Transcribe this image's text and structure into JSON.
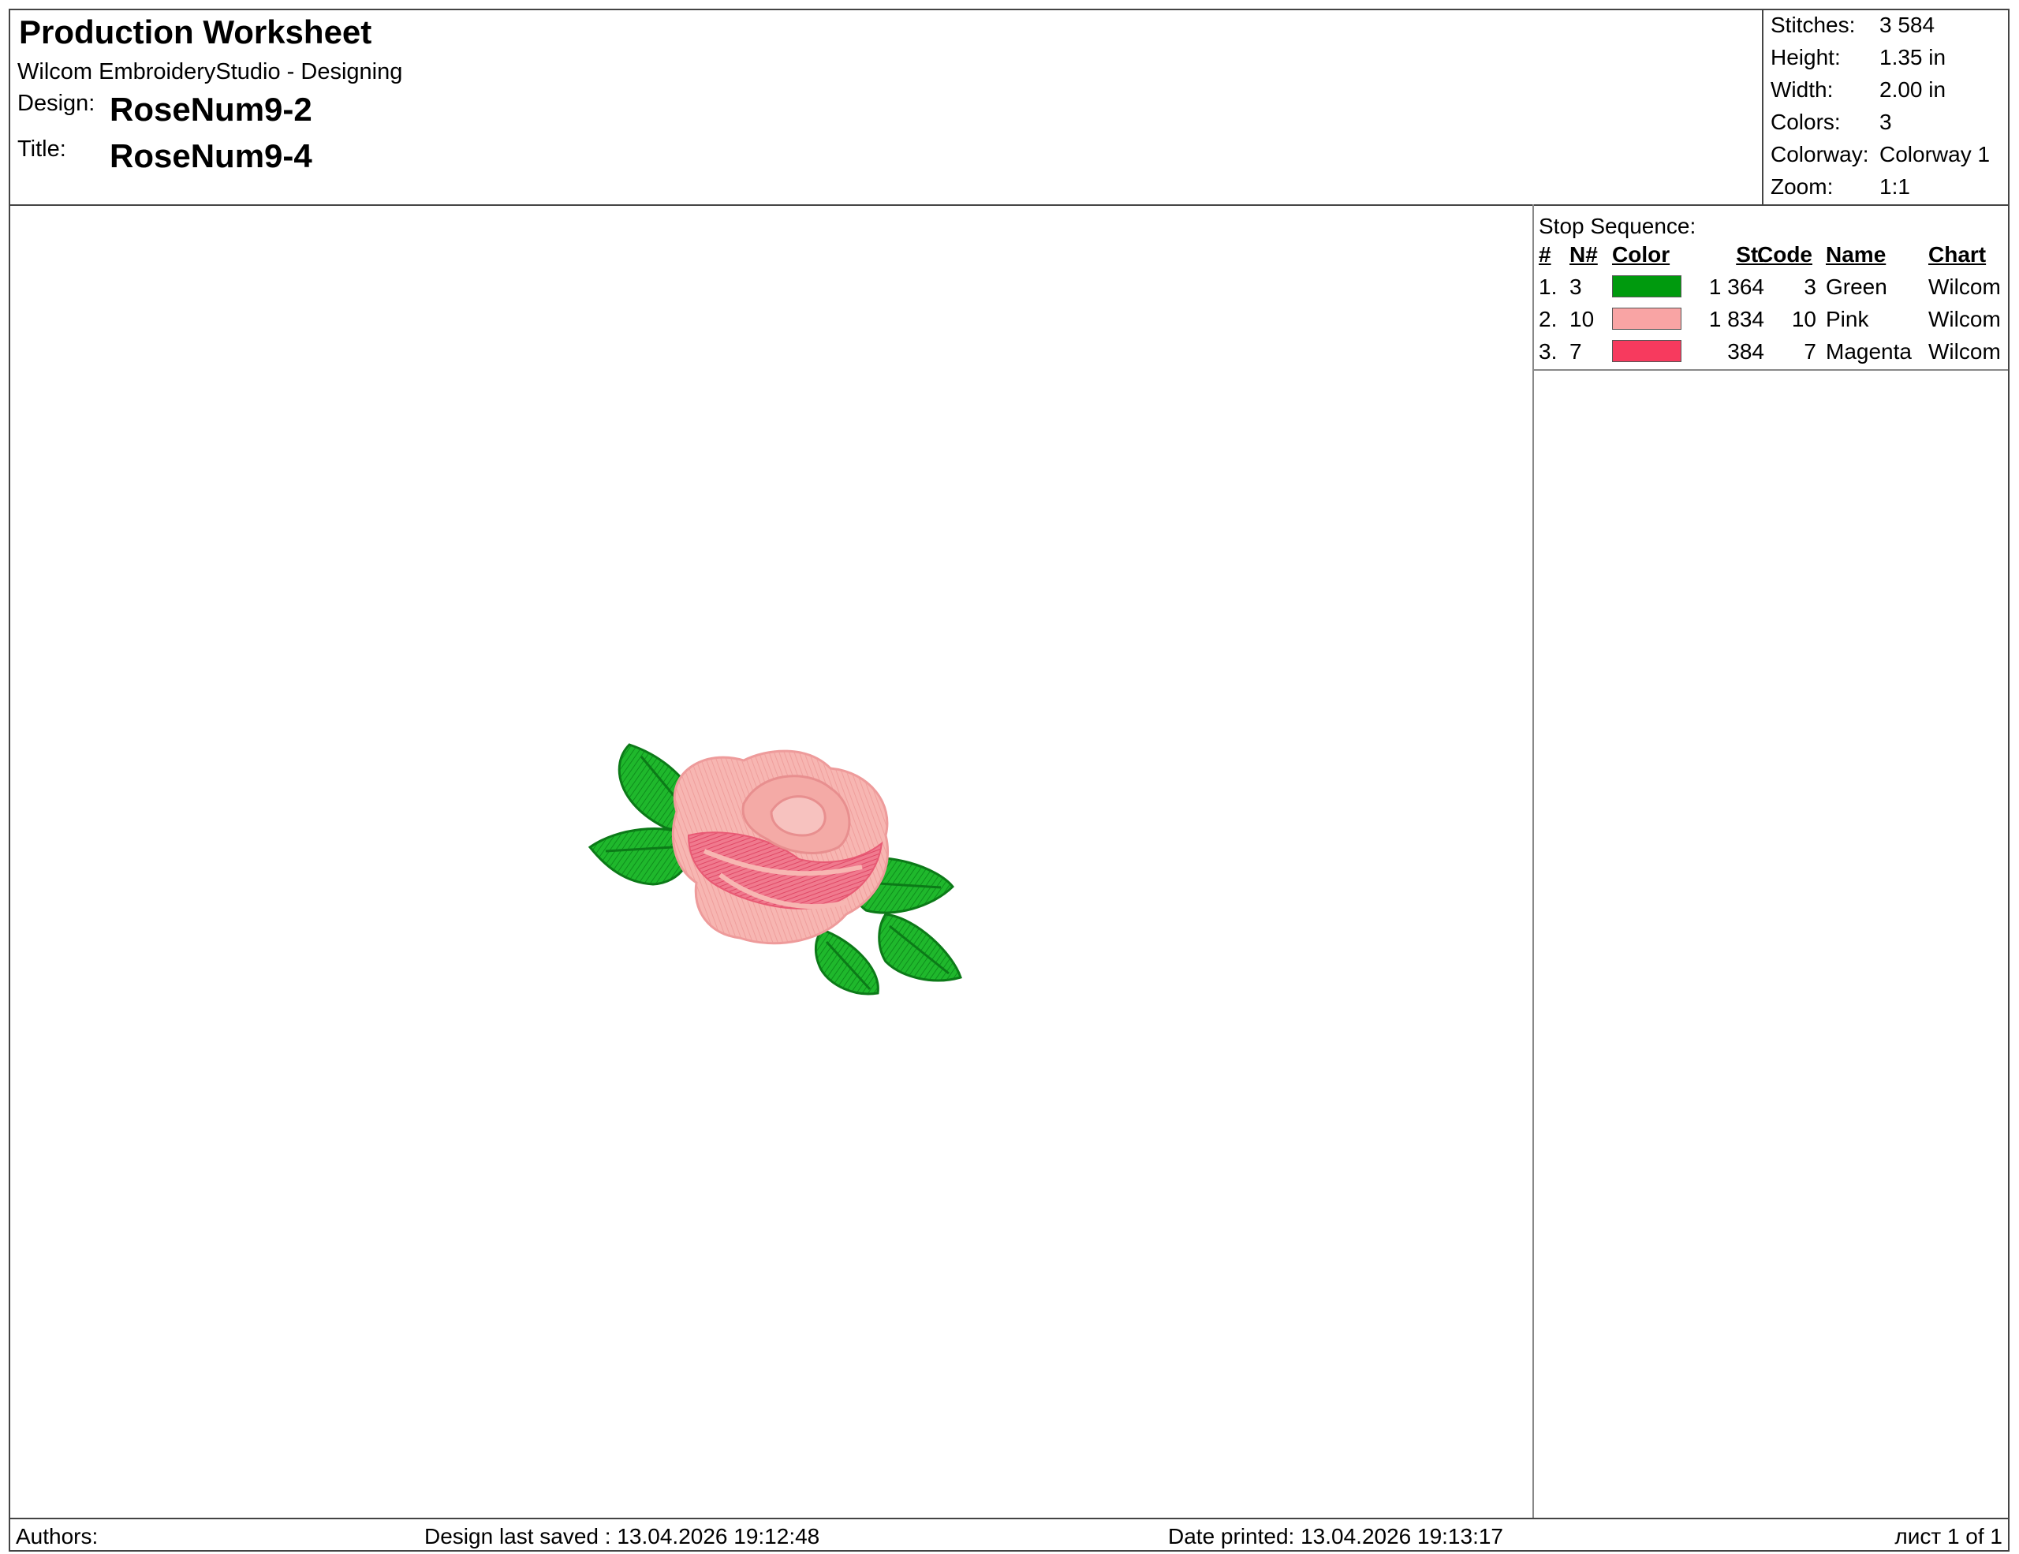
{
  "header": {
    "title": "Production Worksheet",
    "subtitle": "Wilcom EmbroideryStudio - Designing",
    "design_label": "Design:",
    "design_value": "RoseNum9-2",
    "title_label": "Title:",
    "title_value": "RoseNum9-4"
  },
  "stats": [
    {
      "key": "Stitches:",
      "value": "3 584"
    },
    {
      "key": "Height:",
      "value": "1.35 in"
    },
    {
      "key": "Width:",
      "value": "2.00 in"
    },
    {
      "key": "Colors:",
      "value": "3"
    },
    {
      "key": "Colorway:",
      "value": "Colorway 1"
    },
    {
      "key": "Zoom:",
      "value": "1:1"
    }
  ],
  "stop_sequence": {
    "title": "Stop Sequence:",
    "columns": {
      "num": "#",
      "n": "N#",
      "color": "Color",
      "st": "St.",
      "code": "Code",
      "name": "Name",
      "chart": "Chart"
    },
    "rows": [
      {
        "num": "1.",
        "n": "3",
        "color": "#009a0e",
        "st": "1 364",
        "code": "3",
        "name": "Green",
        "chart": "Wilcom"
      },
      {
        "num": "2.",
        "n": "10",
        "color": "#f9a4a4",
        "st": "1 834",
        "code": "10",
        "name": "Pink",
        "chart": "Wilcom"
      },
      {
        "num": "3.",
        "n": "7",
        "color": "#f73a5e",
        "st": "384",
        "code": "7",
        "name": "Magenta",
        "chart": "Wilcom"
      }
    ]
  },
  "footer": {
    "authors": "Authors:",
    "saved": "Design last saved : 13.04.2026 19:12:48",
    "printed": "Date printed: 13.04.2026 19:13:17",
    "page": "лист 1 of 1"
  },
  "design_colors": {
    "leaf": "#1fb82c",
    "leaf_dark": "#0c7a18",
    "petal_light": "#f7b6b2",
    "petal_mid": "#f29a9a",
    "petal_dark": "#ee5c78"
  }
}
